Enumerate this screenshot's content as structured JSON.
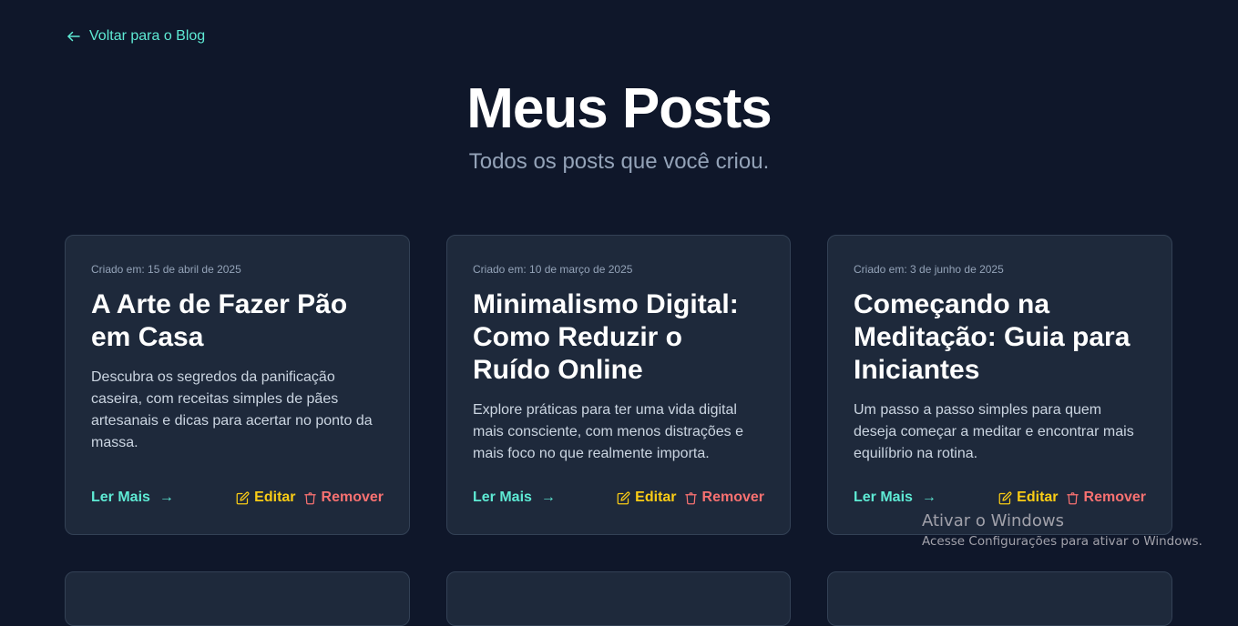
{
  "nav": {
    "back_label": "Voltar para o Blog"
  },
  "header": {
    "title": "Meus Posts",
    "subtitle": "Todos os posts que você criou."
  },
  "posts": [
    {
      "date": "Criado em: 15 de abril de 2025",
      "title": "A Arte de Fazer Pão em Casa",
      "excerpt": "Descubra os segredos da panificação caseira, com receitas simples de pães artesanais e dicas para acertar no ponto da massa.",
      "read_more": "Ler Mais",
      "edit": "Editar",
      "remove": "Remover"
    },
    {
      "date": "Criado em: 10 de março de 2025",
      "title": "Minimalismo Digital: Como Reduzir o Ruído Online",
      "excerpt": "Explore práticas para ter uma vida digital mais consciente, com menos distrações e mais foco no que realmente importa.",
      "read_more": "Ler Mais",
      "edit": "Editar",
      "remove": "Remover"
    },
    {
      "date": "Criado em: 3 de junho de 2025",
      "title": "Começando na Meditação: Guia para Iniciantes",
      "excerpt": "Um passo a passo simples para quem deseja começar a meditar e encontrar mais equilíbrio na rotina.",
      "read_more": "Ler Mais",
      "edit": "Editar",
      "remove": "Remover"
    }
  ],
  "watermark": {
    "title": "Ativar o Windows",
    "subtitle": "Acesse Configurações para ativar o Windows."
  },
  "colors": {
    "background": "#0f172a",
    "card": "#1e293b",
    "accent": "#5eead4",
    "edit": "#facc15",
    "remove": "#f87171"
  }
}
